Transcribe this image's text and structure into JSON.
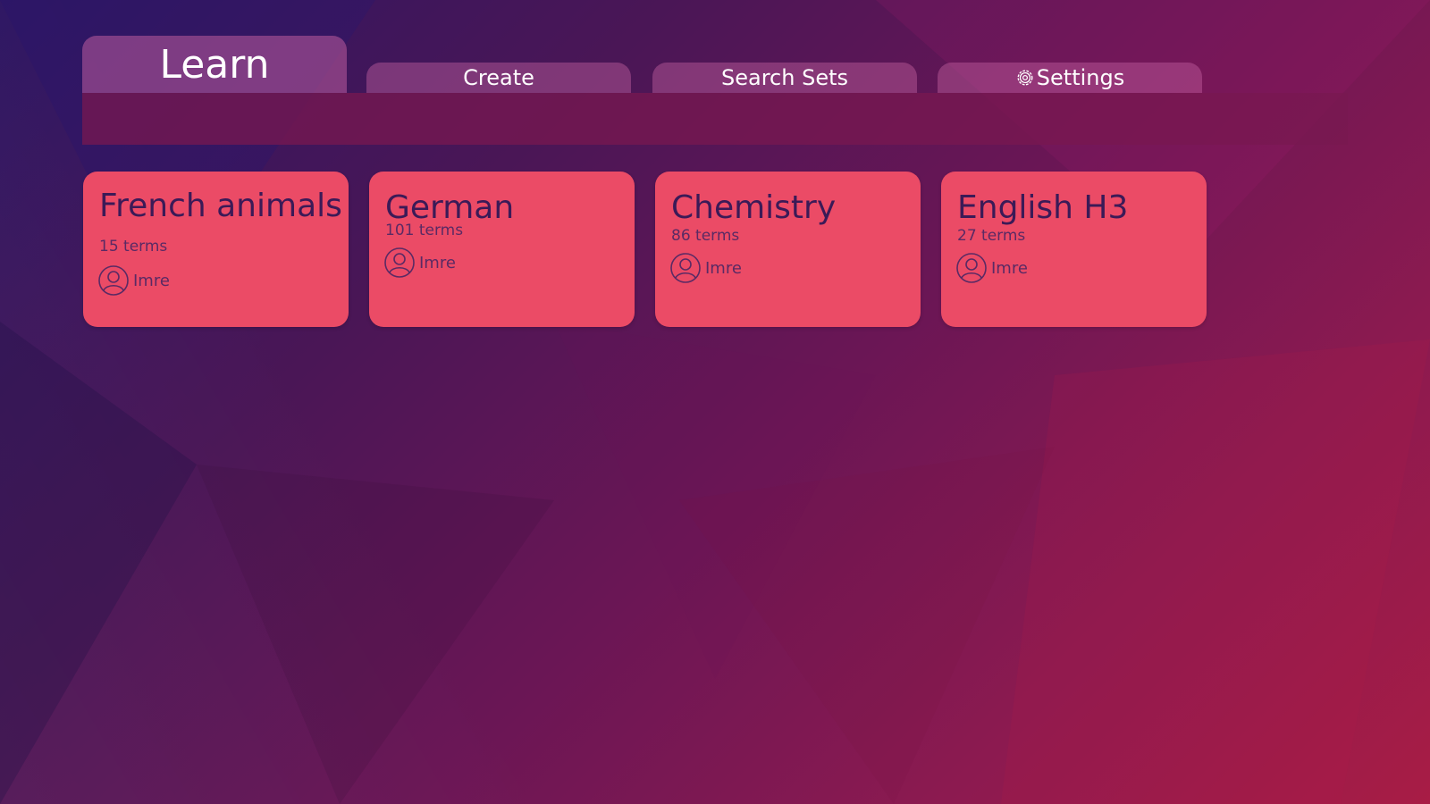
{
  "tabs": {
    "learn": "Learn",
    "create": "Create",
    "search": "Search Sets",
    "settings": "Settings",
    "settings_icon": "gear-icon"
  },
  "sets": [
    {
      "title": "French animals",
      "count": "15 terms",
      "author": "Imre"
    },
    {
      "title": "German",
      "count": "101 terms",
      "author": "Imre"
    },
    {
      "title": "Chemistry",
      "count": "86 terms",
      "author": "Imre"
    },
    {
      "title": "English H3",
      "count": "27 terms",
      "author": "Imre"
    }
  ],
  "colors": {
    "card": "#eb4b66",
    "card_text": "#3b1a57",
    "tab": "#c460a0",
    "bar": "#781850"
  }
}
